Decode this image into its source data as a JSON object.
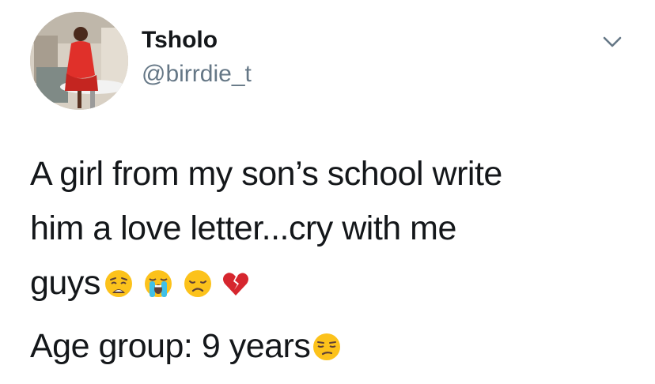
{
  "user": {
    "display_name": "Tsholo",
    "handle": "@birrdie_t"
  },
  "tweet": {
    "line1": "A girl from my son’s school write",
    "line2": "him a love letter...cry with me",
    "line3": "guys",
    "line4": "Age group: 9 years"
  },
  "icons": {
    "menu": "chevron-down-icon",
    "emojis_line3": [
      "weary-face",
      "loudly-crying-face",
      "disappointed-face",
      "broken-heart"
    ],
    "emoji_line4": "unamused-face"
  }
}
